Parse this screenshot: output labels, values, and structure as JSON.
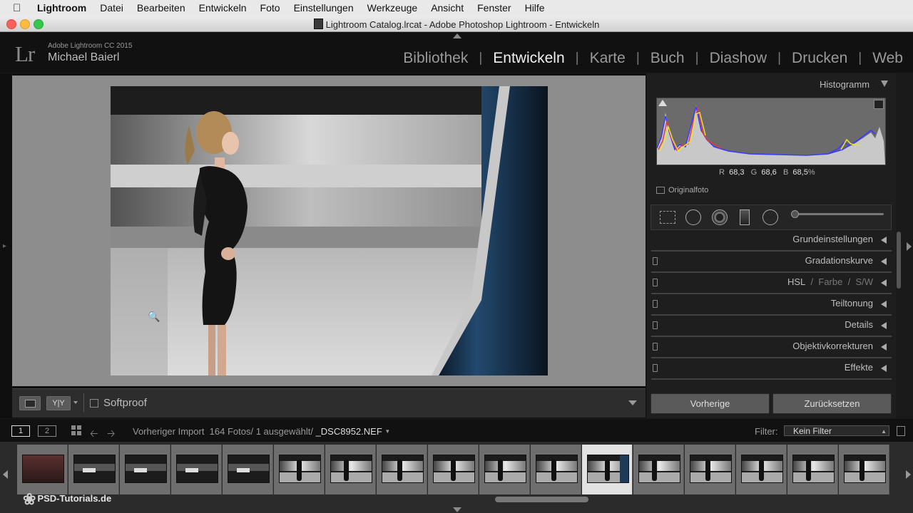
{
  "menubar": {
    "app": "Lightroom",
    "items": [
      "Datei",
      "Bearbeiten",
      "Entwickeln",
      "Foto",
      "Einstellungen",
      "Werkzeuge",
      "Ansicht",
      "Fenster",
      "Hilfe"
    ]
  },
  "window": {
    "title": "Lightroom Catalog.lrcat - Adobe Photoshop Lightroom - Entwickeln"
  },
  "identity": {
    "logo": "Lr",
    "product": "Adobe Lightroom CC 2015",
    "user": "Michael Baierl"
  },
  "modules": {
    "active": "Entwickeln",
    "items": [
      "Bibliothek",
      "Entwickeln",
      "Karte",
      "Buch",
      "Diashow",
      "Drucken",
      "Web"
    ]
  },
  "toolbar": {
    "softproof": "Softproof"
  },
  "histogram": {
    "title": "Histogramm",
    "r_label": "R",
    "r_value": "68,3",
    "g_label": "G",
    "g_value": "68,6",
    "b_label": "B",
    "b_value": "68,5",
    "percent": "%",
    "original_label": "Originalfoto"
  },
  "panels": {
    "basic": "Grundeinstellungen",
    "tone_curve": "Gradationskurve",
    "hsl": "HSL",
    "hsl_sep": "/",
    "color": "Farbe",
    "bw": "S/W",
    "split_toning": "Teiltonung",
    "details": "Details",
    "lens": "Objektivkorrekturen",
    "effects": "Effekte"
  },
  "buttons": {
    "previous": "Vorherige",
    "reset": "Zurücksetzen"
  },
  "filmstrip": {
    "page1": "1",
    "page2": "2",
    "source_prefix": "Vorheriger Import",
    "source_count": "164 Fotos/ 1 ausgewählt/",
    "filename": "_DSC8952.NEF",
    "filter_label": "Filter:",
    "filter_value": "Kein Filter"
  },
  "watermark": "PSD-Tutorials.de",
  "colors": {
    "accent_selected": "#e2e2e2",
    "panel_bg": "#1e1e1e",
    "canvas_bg": "#8d8d8d"
  }
}
